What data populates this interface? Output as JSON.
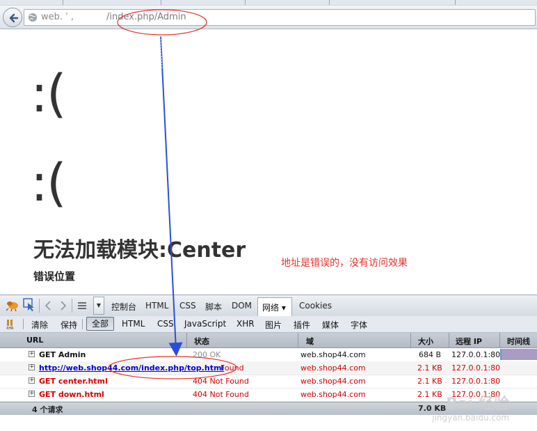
{
  "browser": {
    "url_domain": "web. ˈ ,",
    "url_path": "/index.php/Admin"
  },
  "page": {
    "face1": ":(",
    "face2": ":(",
    "error_title": "无法加载模块:Center",
    "error_location": "错误位置"
  },
  "annotation": "地址是错误的，没有访问效果",
  "firebug": {
    "tabs": [
      "控制台",
      "HTML",
      "CSS",
      "脚本",
      "DOM"
    ],
    "active_tab": "网络 ▾",
    "cookies_tab": "Cookies",
    "filters": {
      "clear": "清除",
      "persist": "保持",
      "all": "全部",
      "items": [
        "HTML",
        "CSS",
        "JavaScript",
        "XHR",
        "图片",
        "插件",
        "媒体",
        "字体"
      ]
    }
  },
  "net": {
    "columns": {
      "url": "URL",
      "status": "状态",
      "domain": "域",
      "size": "大小",
      "ip": "远程 IP",
      "timeline": "时间线"
    },
    "rows": [
      {
        "url": "GET Admin",
        "status": "200 OK",
        "domain": "web.shop44.com",
        "size": "684 B",
        "ip": "127.0.0.1:80"
      },
      {
        "url": "http://web.shop44.com/index.php/top.html",
        "status": "Found",
        "domain": "web.shop44.com",
        "size": "2.1 KB",
        "ip": "127.0.0.1:80"
      },
      {
        "url": "GET center.html",
        "status": "404 Not Found",
        "domain": "web.shop44.com",
        "size": "2.1 KB",
        "ip": "127.0.0.1:80"
      },
      {
        "url": "GET down.html",
        "status": "404 Not Found",
        "domain": "web.shop44.com",
        "size": "2.1 KB",
        "ip": "127.0.0.1:80"
      }
    ],
    "footer_count": "4 个请求",
    "footer_size": "7.0 KB"
  },
  "colors": {
    "annotation_red": "#e8302a",
    "error_red": "#d40000",
    "arrow_blue": "#2a4fd6"
  },
  "watermark": {
    "logo": "Bai 经验",
    "site": "jingyan.baidu.com"
  }
}
